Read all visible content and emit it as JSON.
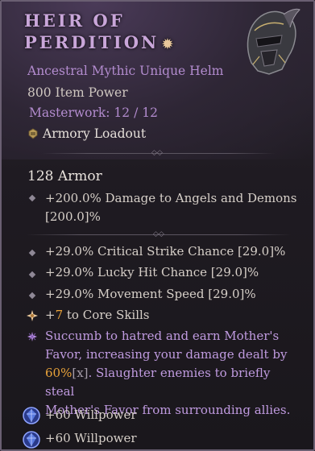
{
  "item": {
    "name_line1": "HEIR OF",
    "name_line2": "PERDITION",
    "rarity": "Ancestral Mythic Unique Helm",
    "item_power": "800 Item Power",
    "masterwork": "Masterwork: 12 / 12",
    "armory": "Armory Loadout",
    "armor": "128 Armor"
  },
  "implicit": [
    {
      "line1": "+200.0% Damage to Angels and Demons",
      "line2": "[200.0]%"
    }
  ],
  "affixes": [
    {
      "text": "+29.0% Critical Strike Chance [29.0]%"
    },
    {
      "text": "+29.0% Lucky Hit Chance [29.0]%"
    },
    {
      "text": "+29.0% Movement Speed [29.0]%"
    }
  ],
  "tempered": {
    "prefix": "+",
    "value": "7",
    "suffix": " to Core Skills"
  },
  "unique_power": {
    "line1": "Succumb to hatred and earn Mother's",
    "line2": "Favor, increasing your damage dealt by",
    "line3_value": "60%",
    "line3_range": "[x]",
    "line3_rest": ". Slaughter enemies to briefly steal",
    "line4": "Mother's Favor from surrounding allies."
  },
  "sockets": [
    {
      "text": "+60 Willpower"
    },
    {
      "text": "+60 Willpower"
    }
  ],
  "colors": {
    "title": "#c9a6d9",
    "rarity": "#b38ccf",
    "highlight": "#e8a23a",
    "unique_text": "#c09be0",
    "gem": "#5a7be0"
  },
  "icons": [
    "star-icon",
    "helm-icon",
    "armory-icon",
    "diamond-bullet-icon",
    "tempered-icon",
    "unique-power-icon",
    "gem-icon"
  ]
}
